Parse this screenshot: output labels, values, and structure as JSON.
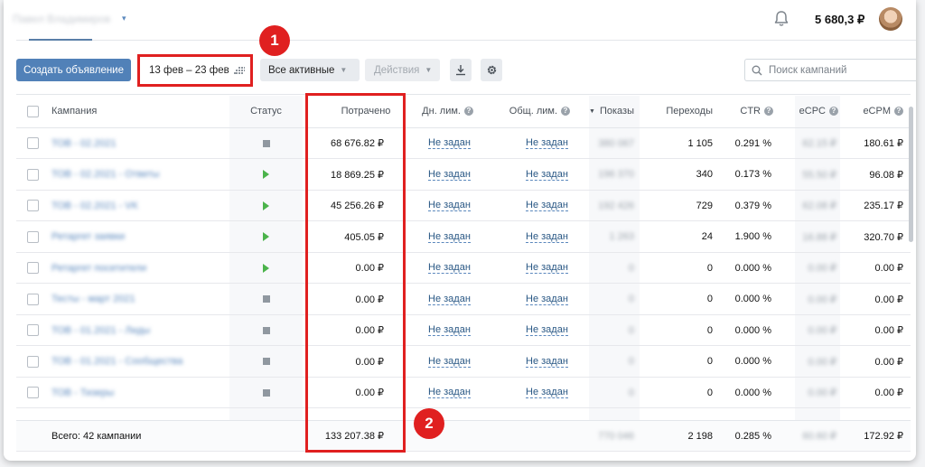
{
  "header": {
    "account_name": "Павел Владимиров",
    "balance": "5 680,3 ₽"
  },
  "toolbar": {
    "create_label": "Создать объявление",
    "date_range": "13 фев – 23 фев",
    "filter_label": "Все активные",
    "actions_label": "Действия",
    "search_placeholder": "Поиск кампаний"
  },
  "columns": {
    "campaign": "Кампания",
    "status": "Статус",
    "spent": "Потрачено",
    "day_limit": "Дн. лим.",
    "total_limit": "Общ. лим.",
    "impressions": "Показы",
    "clicks": "Переходы",
    "ctr": "CTR",
    "ecpc": "eCPC",
    "ecpm": "eCPM"
  },
  "rows": [
    {
      "name": "ТОВ - 02.2021",
      "status": "stopped",
      "spent": "68 676.82 ₽",
      "day_limit": "Не задан",
      "total_limit": "Не задан",
      "impressions": "380 067",
      "clicks": "1 105",
      "ctr": "0.291 %",
      "ecpc": "62.15 ₽",
      "ecpm": "180.61 ₽"
    },
    {
      "name": "ТОВ - 02.2021 - Ответы",
      "status": "active",
      "spent": "18 869.25 ₽",
      "day_limit": "Не задан",
      "total_limit": "Не задан",
      "impressions": "196 370",
      "clicks": "340",
      "ctr": "0.173 %",
      "ecpc": "55.50 ₽",
      "ecpm": "96.08 ₽"
    },
    {
      "name": "ТОВ - 02.2021 - VK",
      "status": "active",
      "spent": "45 256.26 ₽",
      "day_limit": "Не задан",
      "total_limit": "Не задан",
      "impressions": "192 426",
      "clicks": "729",
      "ctr": "0.379 %",
      "ecpc": "62.08 ₽",
      "ecpm": "235.17 ₽"
    },
    {
      "name": "Ретаргет заявки",
      "status": "active",
      "spent": "405.05 ₽",
      "day_limit": "Не задан",
      "total_limit": "Не задан",
      "impressions": "1 263",
      "clicks": "24",
      "ctr": "1.900 %",
      "ecpc": "16.88 ₽",
      "ecpm": "320.70 ₽"
    },
    {
      "name": "Ретаргет посетители",
      "status": "active",
      "spent": "0.00 ₽",
      "day_limit": "Не задан",
      "total_limit": "Не задан",
      "impressions": "0",
      "clicks": "0",
      "ctr": "0.000 %",
      "ecpc": "0.00 ₽",
      "ecpm": "0.00 ₽"
    },
    {
      "name": "Тесты - март 2021",
      "status": "stopped",
      "spent": "0.00 ₽",
      "day_limit": "Не задан",
      "total_limit": "Не задан",
      "impressions": "0",
      "clicks": "0",
      "ctr": "0.000 %",
      "ecpc": "0.00 ₽",
      "ecpm": "0.00 ₽"
    },
    {
      "name": "ТОВ - 01.2021 - Лиды",
      "status": "stopped",
      "spent": "0.00 ₽",
      "day_limit": "Не задан",
      "total_limit": "Не задан",
      "impressions": "0",
      "clicks": "0",
      "ctr": "0.000 %",
      "ecpc": "0.00 ₽",
      "ecpm": "0.00 ₽"
    },
    {
      "name": "ТОВ - 01.2021 - Сообщества",
      "status": "stopped",
      "spent": "0.00 ₽",
      "day_limit": "Не задан",
      "total_limit": "Не задан",
      "impressions": "0",
      "clicks": "0",
      "ctr": "0.000 %",
      "ecpc": "0.00 ₽",
      "ecpm": "0.00 ₽"
    },
    {
      "name": "ТОВ - Тизеры",
      "status": "stopped",
      "spent": "0.00 ₽",
      "day_limit": "Не задан",
      "total_limit": "Не задан",
      "impressions": "0",
      "clicks": "0",
      "ctr": "0.000 %",
      "ecpc": "0.00 ₽",
      "ecpm": "0.00 ₽"
    }
  ],
  "footer": {
    "label": "Всего: 42 кампании",
    "spent": "133 207.38 ₽",
    "impressions": "770 046",
    "clicks": "2 198",
    "ctr": "0.285 %",
    "ecpc": "60.60 ₽",
    "ecpm": "172.92 ₽"
  },
  "annotations": {
    "marker1": "1",
    "marker2": "2"
  },
  "colors": {
    "primary": "#5181b8",
    "highlight": "#e02020",
    "active_status": "#4bb34b",
    "stopped_status": "#9098a0",
    "link": "#2a5885"
  },
  "icons": {
    "notifications": "bell-icon",
    "calendar": "calendar-grid-icon",
    "download": "download-icon",
    "settings": "gear-icon",
    "search": "search-icon"
  }
}
